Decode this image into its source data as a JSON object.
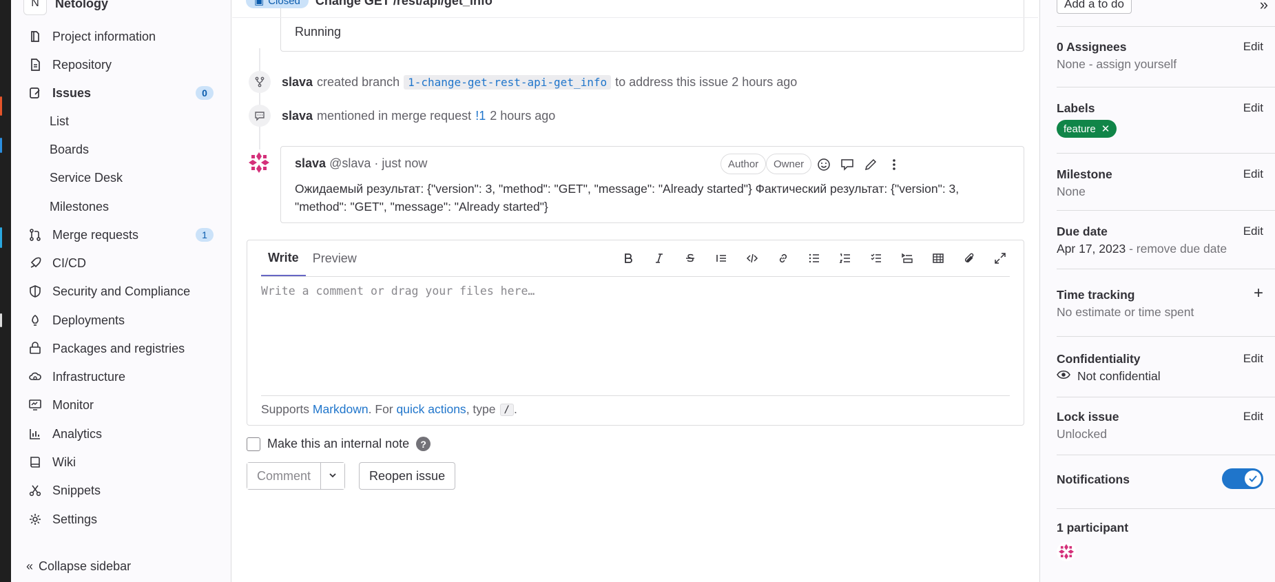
{
  "sidebar": {
    "project_initial": "N",
    "project_name": "Netology",
    "items": [
      {
        "label": "Project information",
        "icon": "project-info-icon"
      },
      {
        "label": "Repository",
        "icon": "file-document-icon"
      },
      {
        "label": "Issues",
        "icon": "issues-icon",
        "count": "0"
      },
      {
        "label": "List"
      },
      {
        "label": "Boards"
      },
      {
        "label": "Service Desk"
      },
      {
        "label": "Milestones"
      },
      {
        "label": "Merge requests",
        "icon": "merge-request-icon",
        "count": "1"
      },
      {
        "label": "CI/CD",
        "icon": "rocket-icon"
      },
      {
        "label": "Security and Compliance",
        "icon": "shield-icon"
      },
      {
        "label": "Deployments",
        "icon": "deployments-icon"
      },
      {
        "label": "Packages and registries",
        "icon": "package-icon"
      },
      {
        "label": "Infrastructure",
        "icon": "cloud-gear-icon"
      },
      {
        "label": "Monitor",
        "icon": "monitor-icon"
      },
      {
        "label": "Analytics",
        "icon": "chart-icon"
      },
      {
        "label": "Wiki",
        "icon": "book-icon"
      },
      {
        "label": "Snippets",
        "icon": "scissors-icon"
      },
      {
        "label": "Settings",
        "icon": "gear-icon"
      }
    ],
    "collapse_label": "Collapse sidebar"
  },
  "header": {
    "status": "Closed",
    "title": "Change GET /rest/api/get_info"
  },
  "timeline": {
    "running_text": "Running",
    "note_branch": {
      "author": "slava",
      "pre": "created branch",
      "branch": "1-change-get-rest-api-get_info",
      "post": "to address this issue 2 hours ago"
    },
    "note_mention": {
      "author": "slava",
      "pre": "mentioned in merge request",
      "mr": "!1",
      "post": "2 hours ago"
    },
    "comment": {
      "author": "slava",
      "meta": "@slava · just now",
      "role_author": "Author",
      "role_owner": "Owner",
      "body": "Ожидаемый результат: {\"version\": 3, \"method\": \"GET\", \"message\": \"Already started\"} Фактический результат: {\"version\": 3, \"method\": \"GET\", \"message\": \"Already started\"}"
    }
  },
  "editor": {
    "tab_write": "Write",
    "tab_preview": "Preview",
    "placeholder": "Write a comment or drag your files here…",
    "footer_pre": "Supports",
    "footer_markdown": "Markdown",
    "footer_mid": ". For",
    "footer_quick": "quick actions",
    "footer_type": ", type",
    "footer_kbd": "/",
    "footer_end": "."
  },
  "actions": {
    "internal_note": "Make this an internal note",
    "help": "?",
    "comment": "Comment",
    "reopen": "Reopen issue"
  },
  "right_sidebar": {
    "todo": "Add a to do",
    "assignees_title": "0 Assignees",
    "assignees_value": "None - assign yourself",
    "labels_title": "Labels",
    "label_feature": "feature",
    "milestone_title": "Milestone",
    "milestone_value": "None",
    "due_title": "Due date",
    "due_value": "Apr 17, 2023",
    "due_remove": "- remove due date",
    "time_title": "Time tracking",
    "time_value": "No estimate or time spent",
    "conf_title": "Confidentiality",
    "conf_value": "Not confidential",
    "lock_title": "Lock issue",
    "lock_value": "Unlocked",
    "notif_title": "Notifications",
    "notifications_on": true,
    "participants_title": "1 participant",
    "edit": "Edit"
  },
  "colors": {
    "accent": "#1f75cb",
    "label_green": "#108548",
    "tab_underline": "#6666c4"
  }
}
